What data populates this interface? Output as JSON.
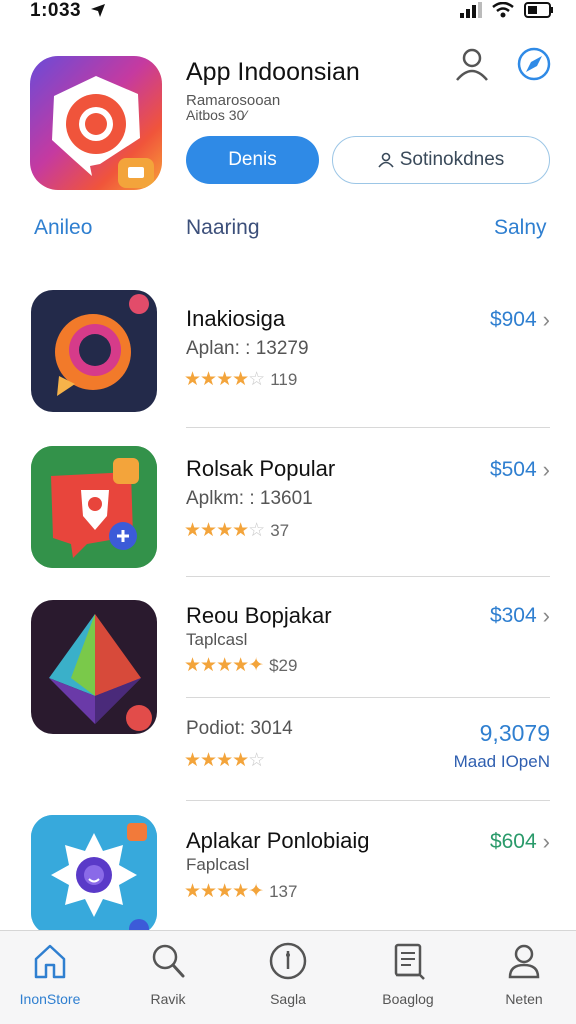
{
  "status": {
    "time": "1:033"
  },
  "header": {
    "title": "App Indoonsian",
    "subtitle1": "Ramarosooan",
    "subtitle2": "Aitbos 30⁄ ",
    "primary_button": "Denis",
    "secondary_button": "Sotinokdnes"
  },
  "filters": [
    "Anileo",
    "Naaring",
    "Salny"
  ],
  "apps": [
    {
      "name": "Inakiosiga",
      "meta": "Aplan: : 13279",
      "rating_count": "119",
      "stars": 4,
      "price": "$904"
    },
    {
      "name": "Rolsak Popular",
      "meta": "Aplkm: : 13601",
      "rating_count": "37",
      "stars": 4,
      "price": "$504"
    },
    {
      "name": "Reou Bopjakar",
      "meta": "Taplcasl",
      "rating_count": "$29",
      "stars": 4.5,
      "price": "$304"
    },
    {
      "name": "Podiot: 3014",
      "meta": "",
      "rating_count": "",
      "stars": 4,
      "price": "9,3079",
      "price_sub": "Maad IOpeN"
    },
    {
      "name": "Aplakar Ponlobiaig",
      "meta": "Faplcasl",
      "rating_count": "137",
      "stars": 4.5,
      "price": "$604"
    }
  ],
  "tabs": [
    {
      "label": "InonStore",
      "icon": "home-icon",
      "active": true
    },
    {
      "label": "Ravik",
      "icon": "search-icon",
      "active": false
    },
    {
      "label": "Sagla",
      "icon": "compass-icon",
      "active": false
    },
    {
      "label": "Boaglog",
      "icon": "book-icon",
      "active": false
    },
    {
      "label": "Neten",
      "icon": "person-icon",
      "active": false
    }
  ],
  "colors": {
    "accent": "#2f8ae6",
    "star": "#f3a43b",
    "price_green": "#2a9a6a"
  }
}
